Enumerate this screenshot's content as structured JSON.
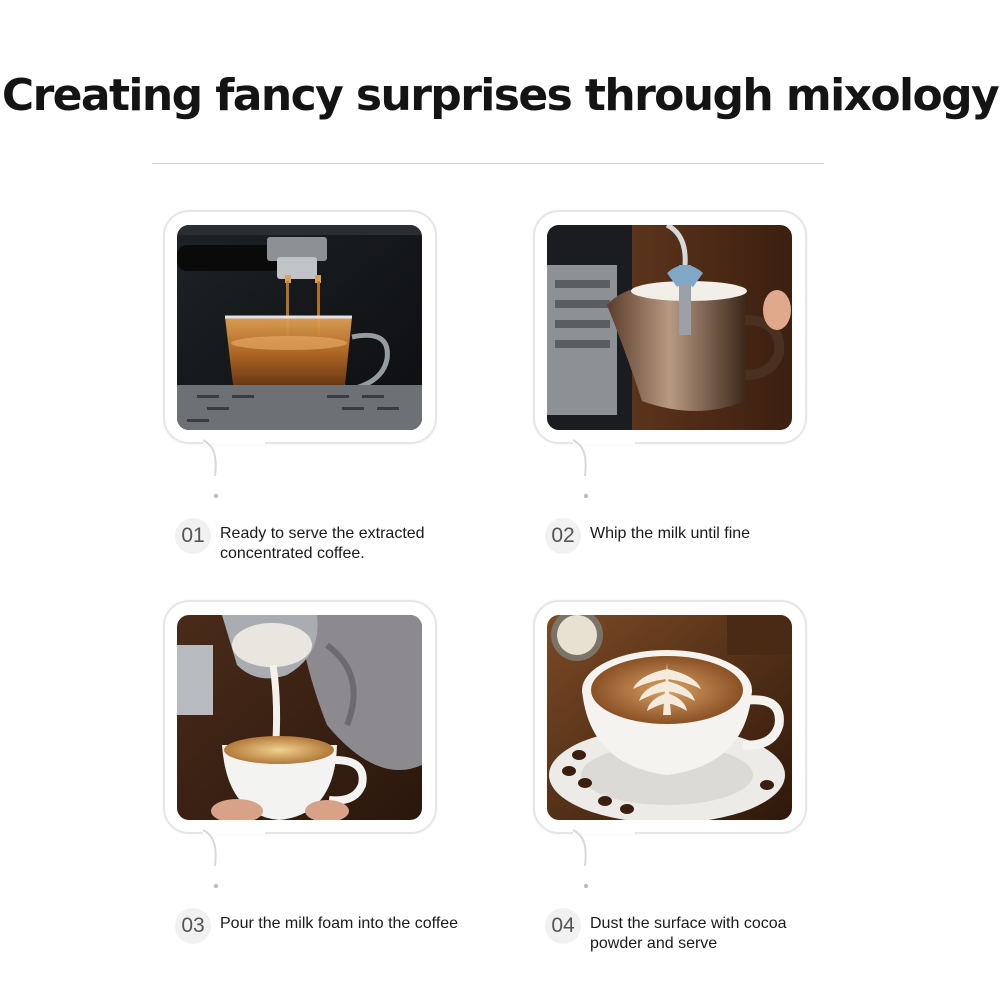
{
  "title": "Creating fancy surprises through mixology",
  "steps": [
    {
      "number": "01",
      "text": "Ready to serve the extracted concentrated coffee."
    },
    {
      "number": "02",
      "text": "Whip the milk until fine"
    },
    {
      "number": "03",
      "text": "Pour the milk foam into the coffee"
    },
    {
      "number": "04",
      "text": "Dust the surface with cocoa powder and serve"
    }
  ]
}
